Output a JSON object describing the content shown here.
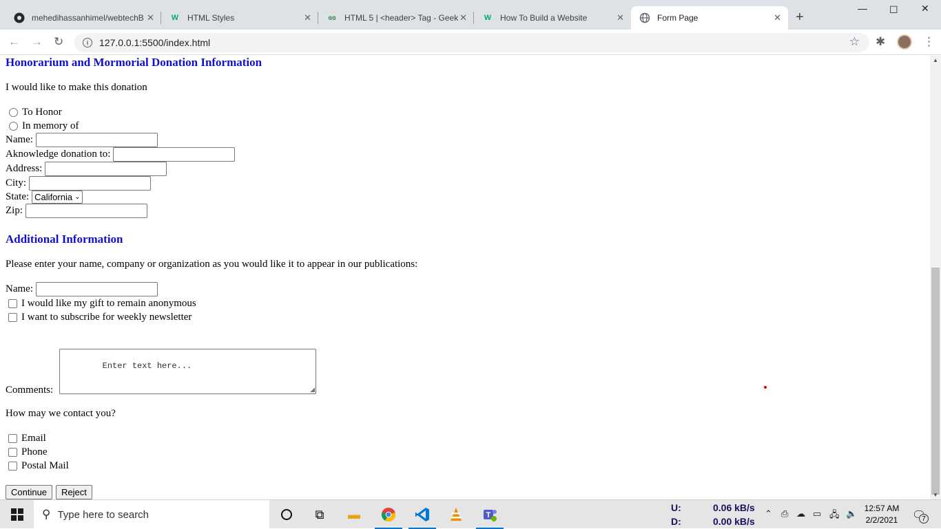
{
  "browser": {
    "tabs": [
      {
        "title": "mehedihassanhimel/webtechB",
        "icon": "github-icon"
      },
      {
        "title": "HTML Styles",
        "icon": "w3schools-icon"
      },
      {
        "title": "HTML 5 | <header> Tag - Geek",
        "icon": "geeksforgeeks-icon"
      },
      {
        "title": "How To Build a Website",
        "icon": "w3schools-icon"
      },
      {
        "title": "Form Page",
        "icon": "globe-icon",
        "active": true
      }
    ],
    "new_tab": "+",
    "url": "127.0.0.1:5500/index.html"
  },
  "page": {
    "honorarium": {
      "heading": "Honorarium and Mormorial Donation Information",
      "intro": "I would like to make this donation",
      "options": [
        "To Honor",
        "In memory of"
      ],
      "name_label": "Name:",
      "acknowledge_label": "Aknowledge donation to:",
      "address_label": "Address:",
      "city_label": "City:",
      "state_label": "State:",
      "state_value": "California",
      "zip_label": "Zip:"
    },
    "additional": {
      "heading": "Additional Information",
      "intro": "Please enter your name, company or organization as you would like it to appear in our publications:",
      "name_label": "Name:",
      "anonymous_label": "I would like my gift to remain anonymous",
      "newsletter_label": "I want to subscribe for weekly newsletter",
      "comments_label": "Comments:",
      "comments_placeholder": "    Enter text here...",
      "contact_question": "How may we contact you?",
      "contact_options": [
        "Email",
        "Phone",
        "Postal Mail"
      ],
      "continue_label": "Continue",
      "reject_label": "Reject"
    }
  },
  "taskbar": {
    "search_placeholder": "Type here to search",
    "upload_label": "U:",
    "upload_value": "0.06 kB/s",
    "download_label": "D:",
    "download_value": "0.00 kB/s",
    "time": "12:57 AM",
    "date": "2/2/2021",
    "notification_count": "7"
  }
}
